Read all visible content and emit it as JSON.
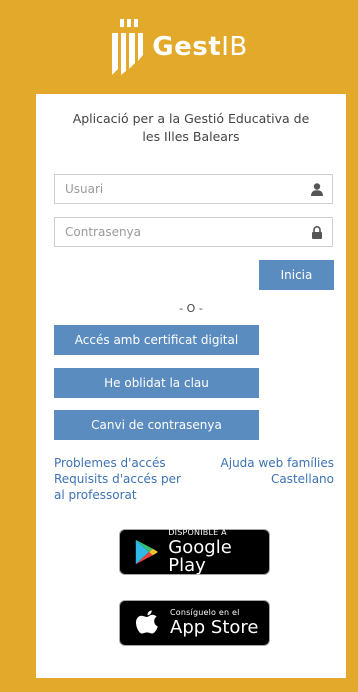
{
  "header": {
    "logo_bold": "Gest",
    "logo_light": "IB"
  },
  "subtitle": "Aplicació per a la Gestió Educativa de les Illes Balears",
  "login": {
    "username_placeholder": "Usuari",
    "password_placeholder": "Contrasenya",
    "submit_label": "Inicia"
  },
  "separator": "- O -",
  "buttons": {
    "certificate": "Accés amb certificat digital",
    "forgot": "He oblidat la clau",
    "change_password": "Canvi de contrasenya"
  },
  "links": {
    "access_problems": "Problemes d'accés",
    "teacher_requirements": "Requisits d'accés per al professorat",
    "family_help": "Ajuda web famílies",
    "language": "Castellano"
  },
  "stores": {
    "google_small": "DISPONIBLE A",
    "google_big": "Google Play",
    "apple_small": "Consíguelo en el",
    "apple_big": "App Store"
  },
  "colors": {
    "background": "#e3a92a",
    "button": "#5b8cc0",
    "link": "#3d72b4"
  }
}
